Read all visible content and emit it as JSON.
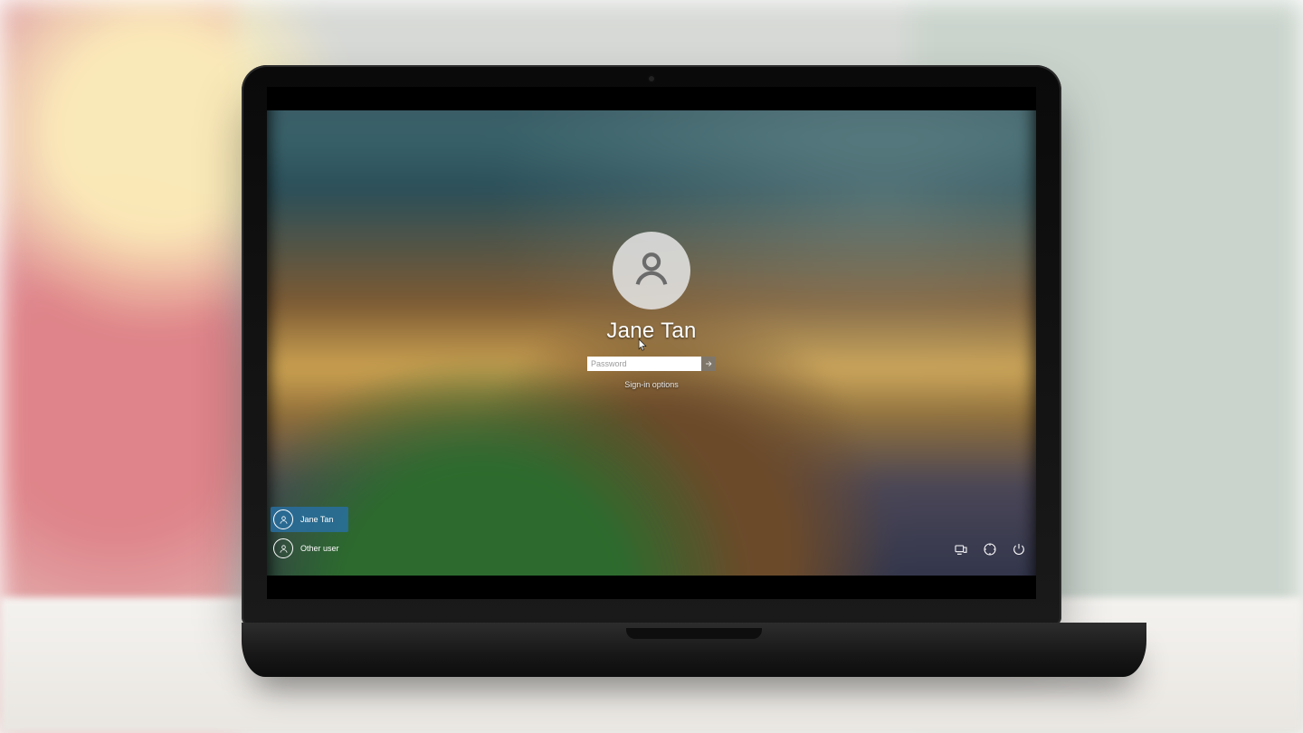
{
  "login": {
    "username": "Jane Tan",
    "password_placeholder": "Password",
    "signin_options_label": "Sign-in options"
  },
  "user_list": [
    {
      "label": "Jane Tan",
      "selected": true
    },
    {
      "label": "Other user",
      "selected": false
    }
  ],
  "system_buttons": {
    "network": "Network",
    "ease_of_access": "Ease of access",
    "power": "Power"
  }
}
